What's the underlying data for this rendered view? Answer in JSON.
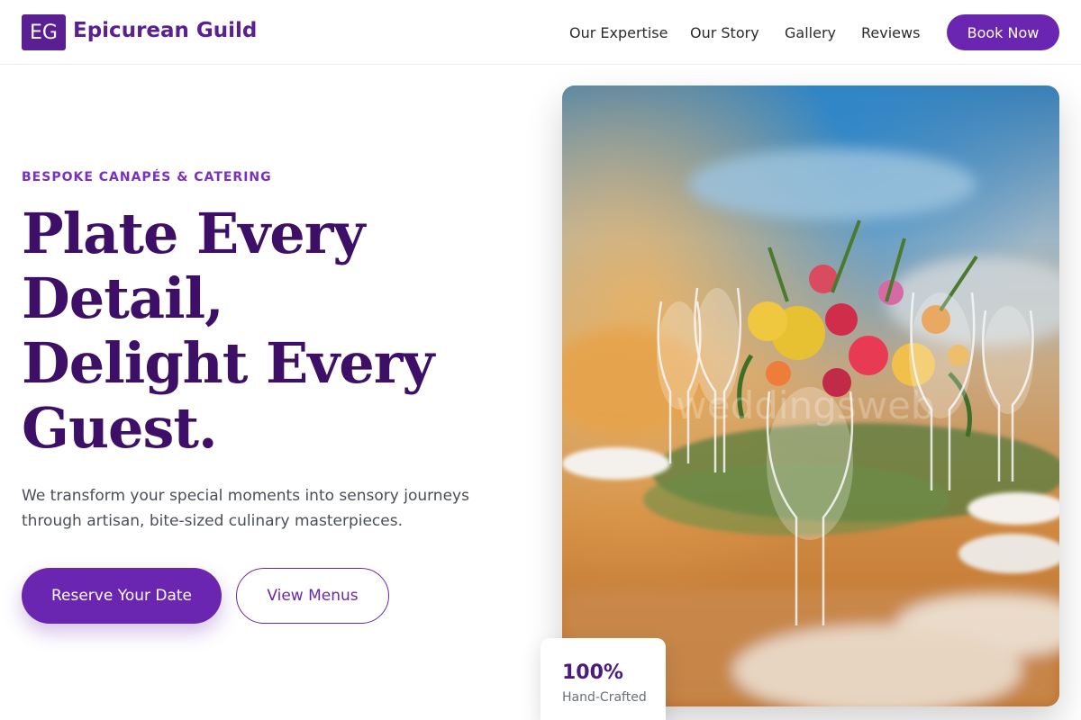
{
  "brand": {
    "logo_initials": "EG",
    "name": "Epicurean Guild",
    "color": "#5b1f94"
  },
  "nav": {
    "links": [
      "Our Expertise",
      "Our Story",
      "Gallery",
      "Reviews"
    ],
    "cta_label": "Book Now"
  },
  "hero": {
    "eyebrow": "BESPOKE CANAPÉS & CATERING",
    "headline_lines": [
      "Plate Every",
      "Detail,",
      "Delight Every",
      "Guest."
    ],
    "subtext": "We transform your special moments into sensory journeys through artisan, bite-sized culinary masterpieces.",
    "primary_button": "Reserve Your Date",
    "secondary_button": "View Menus",
    "image_icon": "table-setting-photo"
  },
  "stat": {
    "value": "100%",
    "label": "Hand-Crafted"
  },
  "colors": {
    "accent": "#6a26b0",
    "headline": "#3d0f66",
    "eyebrow": "#7b2fbf"
  }
}
